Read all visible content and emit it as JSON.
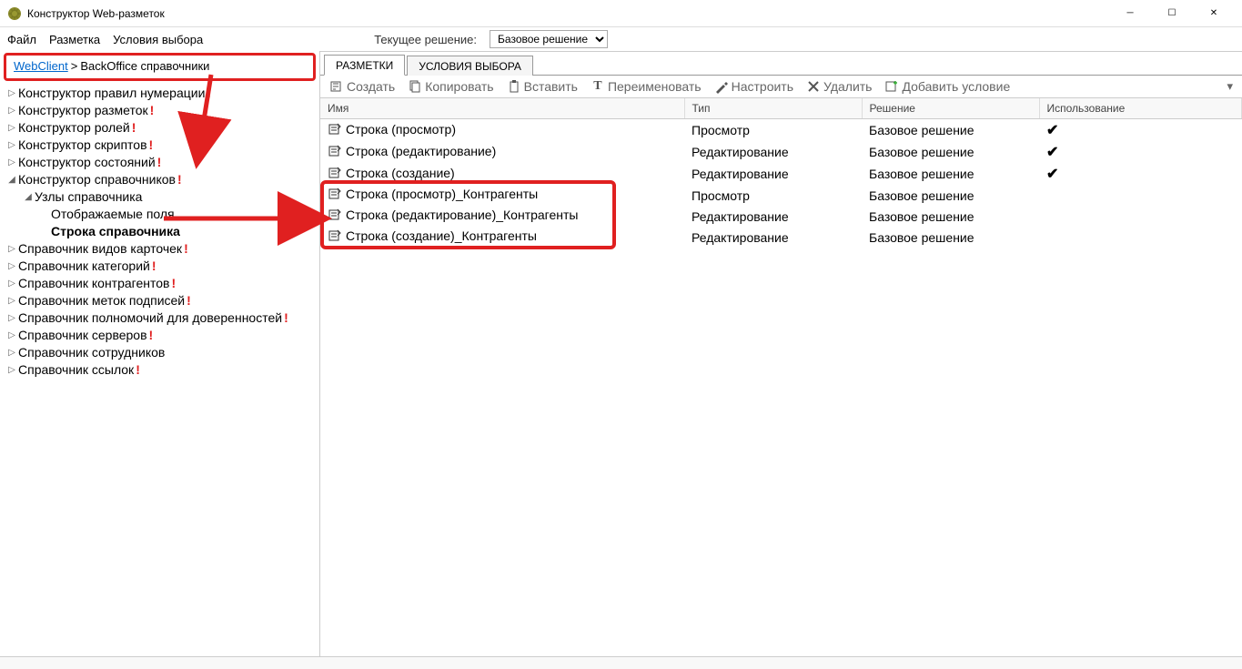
{
  "window": {
    "title": "Конструктор Web-разметок"
  },
  "menu": {
    "file": "Файл",
    "markup": "Разметка",
    "conditions": "Условия выбора"
  },
  "solution": {
    "label": "Текущее решение:",
    "selected": "Базовое решение"
  },
  "breadcrumb": {
    "root": "WebClient",
    "sep": ">",
    "current": "BackOffice справочники"
  },
  "tree": [
    {
      "lvl": 1,
      "twisty": "▷",
      "label": "Конструктор правил нумерации",
      "excl": true
    },
    {
      "lvl": 1,
      "twisty": "▷",
      "label": "Конструктор разметок",
      "excl": true
    },
    {
      "lvl": 1,
      "twisty": "▷",
      "label": "Конструктор ролей",
      "excl": true
    },
    {
      "lvl": 1,
      "twisty": "▷",
      "label": "Конструктор скриптов",
      "excl": true
    },
    {
      "lvl": 1,
      "twisty": "▷",
      "label": "Конструктор состояний",
      "excl": true
    },
    {
      "lvl": 1,
      "twisty": "◢",
      "label": "Конструктор справочников",
      "excl": true
    },
    {
      "lvl": 2,
      "twisty": "◢",
      "label": "Узлы справочника",
      "excl": false
    },
    {
      "lvl": 3,
      "twisty": "",
      "label": "Отображаемые поля",
      "excl": false
    },
    {
      "lvl": 3,
      "twisty": "",
      "label": "Строка справочника",
      "excl": false,
      "bold": true
    },
    {
      "lvl": 1,
      "twisty": "▷",
      "label": "Справочник видов карточек",
      "excl": true
    },
    {
      "lvl": 1,
      "twisty": "▷",
      "label": "Справочник категорий",
      "excl": true
    },
    {
      "lvl": 1,
      "twisty": "▷",
      "label": "Справочник контрагентов",
      "excl": true
    },
    {
      "lvl": 1,
      "twisty": "▷",
      "label": "Справочник меток подписей",
      "excl": true
    },
    {
      "lvl": 1,
      "twisty": "▷",
      "label": "Справочник полномочий для доверенностей",
      "excl": true
    },
    {
      "lvl": 1,
      "twisty": "▷",
      "label": "Справочник серверов",
      "excl": true
    },
    {
      "lvl": 1,
      "twisty": "▷",
      "label": "Справочник сотрудников",
      "excl": false
    },
    {
      "lvl": 1,
      "twisty": "▷",
      "label": "Справочник ссылок",
      "excl": true
    }
  ],
  "tabs": {
    "markups": "РАЗМЕТКИ",
    "conditions": "УСЛОВИЯ ВЫБОРА"
  },
  "toolbar": {
    "create": "Создать",
    "copy": "Копировать",
    "paste": "Вставить",
    "rename": "Переименовать",
    "configure": "Настроить",
    "delete": "Удалить",
    "addcond": "Добавить условие"
  },
  "grid": {
    "headers": {
      "name": "Имя",
      "type": "Тип",
      "solution": "Решение",
      "usage": "Использование"
    },
    "rows": [
      {
        "name": "Строка (просмотр)",
        "type": "Просмотр",
        "solution": "Базовое решение",
        "used": true
      },
      {
        "name": "Строка (редактирование)",
        "type": "Редактирование",
        "solution": "Базовое решение",
        "used": true
      },
      {
        "name": "Строка (создание)",
        "type": "Редактирование",
        "solution": "Базовое решение",
        "used": true
      },
      {
        "name": "Строка (просмотр)_Контрагенты",
        "type": "Просмотр",
        "solution": "Базовое решение",
        "used": false
      },
      {
        "name": "Строка (редактирование)_Контрагенты",
        "type": "Редактирование",
        "solution": "Базовое решение",
        "used": false
      },
      {
        "name": "Строка (создание)_Контрагенты",
        "type": "Редактирование",
        "solution": "Базовое решение",
        "used": false
      }
    ]
  }
}
